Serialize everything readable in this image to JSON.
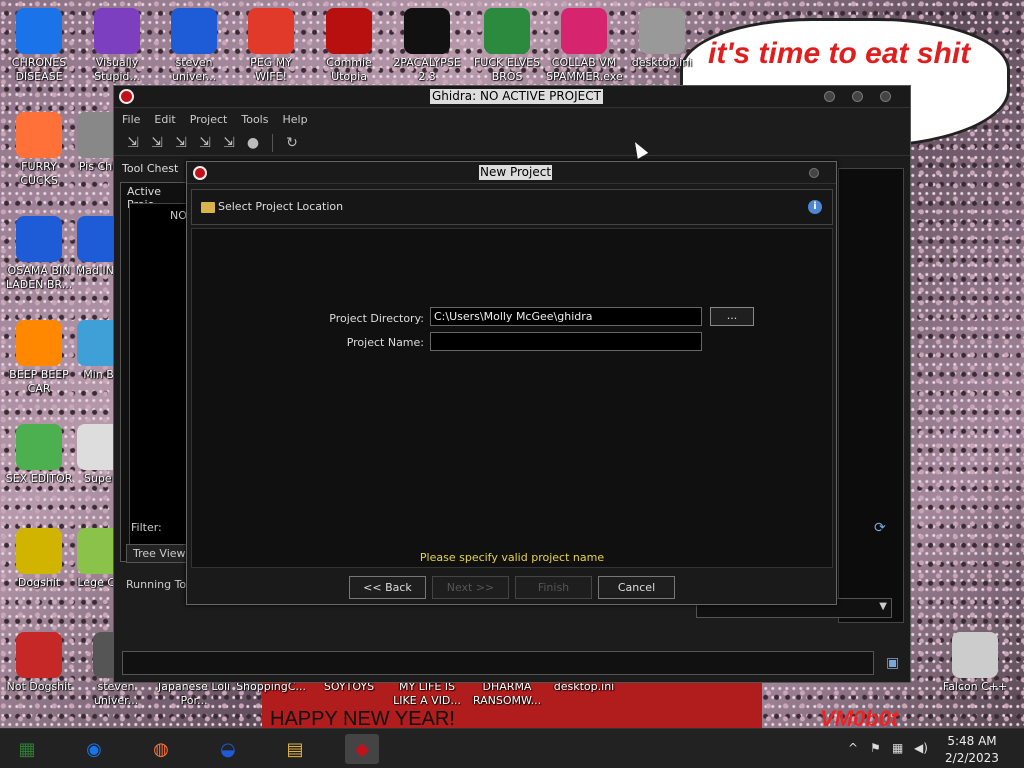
{
  "desktop": {
    "icons": [
      {
        "label": "CHRONES DISEASE",
        "icon": "chrome-icon",
        "color": "#1a73e8"
      },
      {
        "label": "Visually Stupid...",
        "icon": "visual-studio-icon",
        "color": "#7b3fc0"
      },
      {
        "label": "steven univer...",
        "icon": "blue-2-icon",
        "color": "#1e5bd6"
      },
      {
        "label": "PEG MY WIFE!",
        "icon": "p-ball-icon",
        "color": "#e23a2a"
      },
      {
        "label": "Commie Utopia",
        "icon": "hammer-sickle-icon",
        "color": "#b80f0f"
      },
      {
        "label": "2PACALYPSE 2.3",
        "icon": "cmd-icon",
        "color": "#111111"
      },
      {
        "label": "FUCK ELVES BROS",
        "icon": "santa-icon",
        "color": "#2b8a3e"
      },
      {
        "label": "COLLAB VM SPAMMER.exe",
        "icon": "monitor-icon",
        "color": "#d6246e"
      },
      {
        "label": "desktop.ini",
        "icon": "settings-file-icon",
        "color": "#999999"
      },
      {
        "label": "FURRY CUCKS",
        "icon": "firefox-icon",
        "color": "#ff7139"
      },
      {
        "label": "OSAMA BIN LADEN BR...",
        "icon": "obama-logo-icon",
        "color": "#1e5bd6"
      },
      {
        "label": "BEEP BEEP CAR",
        "icon": "vlc-icon",
        "color": "#ff8800"
      },
      {
        "label": "SEX EDITOR",
        "icon": "hxd-icon",
        "color": "#4caf50"
      },
      {
        "label": "Dogshit",
        "icon": "dog-icon",
        "color": "#d1b400"
      },
      {
        "label": "Not Dogshit",
        "icon": "dev-cpp-icon",
        "color": "#c62828"
      },
      {
        "label": "Pis Chic",
        "icon": "partial-icon",
        "color": "#888888"
      },
      {
        "label": "Mad IN S",
        "icon": "partial-icon",
        "color": "#1e5bd6"
      },
      {
        "label": "Min Bl",
        "icon": "partial-icon",
        "color": "#3fa0d8"
      },
      {
        "label": "Super",
        "icon": "partial-icon",
        "color": "#dddddd"
      },
      {
        "label": "Lege CR",
        "icon": "partial-icon",
        "color": "#8bc34a"
      },
      {
        "label": "steven univer...",
        "icon": "partial-icon",
        "color": "#555555"
      },
      {
        "label": "Japanese Loli Por...",
        "icon": "partial-icon",
        "color": "#555555"
      },
      {
        "label": "ShoppingC...",
        "icon": "partial-icon",
        "color": "#555555"
      },
      {
        "label": "SOYTOYS",
        "icon": "partial-icon",
        "color": "#555555"
      },
      {
        "label": "MY LIFE IS LIKE A VID...",
        "icon": "partial-icon",
        "color": "#555555"
      },
      {
        "label": "DHARMA RANSOMW...",
        "icon": "partial-icon",
        "color": "#555555"
      },
      {
        "label": "desktop.ini",
        "icon": "partial-icon",
        "color": "#555555"
      },
      {
        "label": "Falcon C++",
        "icon": "recycle-bin-icon",
        "color": "#cccccc"
      }
    ],
    "bubble_text": "it's time to eat shit celebrate",
    "banner_text": "HAPPY NEW YEAR!",
    "vm_text": "VM0b0t"
  },
  "ghidra": {
    "title": "Ghidra: NO ACTIVE PROJECT",
    "menu": [
      "File",
      "Edit",
      "Project",
      "Tools",
      "Help"
    ],
    "tool_chest": "Tool Chest",
    "active_project": "Active Proje",
    "tree_root": "NO",
    "filter_label": "Filter:",
    "tree_tab": "Tree View",
    "running_tools": "Running Too"
  },
  "dialog": {
    "title": "New Project",
    "step_title": "Select Project Location",
    "project_dir_label": "Project Directory:",
    "project_dir_value": "C:\\Users\\Molly McGee\\ghidra",
    "project_name_label": "Project Name:",
    "project_name_value": "",
    "browse_label": "...",
    "status": "Please specify valid project name",
    "back_label": "<< Back",
    "next_label": "Next >>",
    "finish_label": "Finish",
    "cancel_label": "Cancel"
  },
  "taskbar": {
    "apps": [
      "photos-icon",
      "chrome-icon",
      "firefox-icon",
      "obama-logo-icon",
      "file-explorer-icon",
      "ghidra-icon"
    ],
    "time": "5:48 AM",
    "date": "2/2/2023"
  }
}
